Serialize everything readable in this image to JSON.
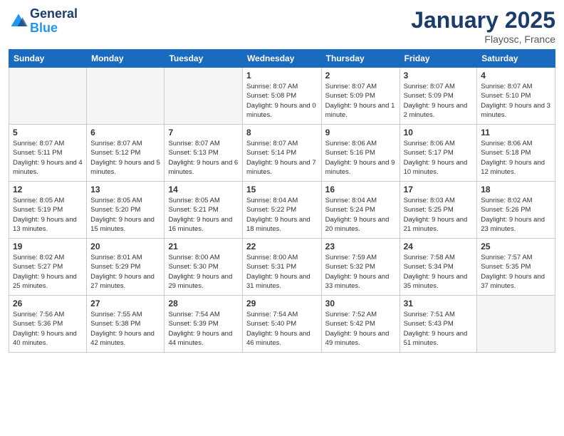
{
  "logo": {
    "line1": "General",
    "line2": "Blue"
  },
  "title": "January 2025",
  "location": "Flayosc, France",
  "days_of_week": [
    "Sunday",
    "Monday",
    "Tuesday",
    "Wednesday",
    "Thursday",
    "Friday",
    "Saturday"
  ],
  "weeks": [
    [
      {
        "num": "",
        "info": ""
      },
      {
        "num": "",
        "info": ""
      },
      {
        "num": "",
        "info": ""
      },
      {
        "num": "1",
        "info": "Sunrise: 8:07 AM\nSunset: 5:08 PM\nDaylight: 9 hours\nand 0 minutes."
      },
      {
        "num": "2",
        "info": "Sunrise: 8:07 AM\nSunset: 5:09 PM\nDaylight: 9 hours\nand 1 minute."
      },
      {
        "num": "3",
        "info": "Sunrise: 8:07 AM\nSunset: 5:09 PM\nDaylight: 9 hours\nand 2 minutes."
      },
      {
        "num": "4",
        "info": "Sunrise: 8:07 AM\nSunset: 5:10 PM\nDaylight: 9 hours\nand 3 minutes."
      }
    ],
    [
      {
        "num": "5",
        "info": "Sunrise: 8:07 AM\nSunset: 5:11 PM\nDaylight: 9 hours\nand 4 minutes."
      },
      {
        "num": "6",
        "info": "Sunrise: 8:07 AM\nSunset: 5:12 PM\nDaylight: 9 hours\nand 5 minutes."
      },
      {
        "num": "7",
        "info": "Sunrise: 8:07 AM\nSunset: 5:13 PM\nDaylight: 9 hours\nand 6 minutes."
      },
      {
        "num": "8",
        "info": "Sunrise: 8:07 AM\nSunset: 5:14 PM\nDaylight: 9 hours\nand 7 minutes."
      },
      {
        "num": "9",
        "info": "Sunrise: 8:06 AM\nSunset: 5:16 PM\nDaylight: 9 hours\nand 9 minutes."
      },
      {
        "num": "10",
        "info": "Sunrise: 8:06 AM\nSunset: 5:17 PM\nDaylight: 9 hours\nand 10 minutes."
      },
      {
        "num": "11",
        "info": "Sunrise: 8:06 AM\nSunset: 5:18 PM\nDaylight: 9 hours\nand 12 minutes."
      }
    ],
    [
      {
        "num": "12",
        "info": "Sunrise: 8:05 AM\nSunset: 5:19 PM\nDaylight: 9 hours\nand 13 minutes."
      },
      {
        "num": "13",
        "info": "Sunrise: 8:05 AM\nSunset: 5:20 PM\nDaylight: 9 hours\nand 15 minutes."
      },
      {
        "num": "14",
        "info": "Sunrise: 8:05 AM\nSunset: 5:21 PM\nDaylight: 9 hours\nand 16 minutes."
      },
      {
        "num": "15",
        "info": "Sunrise: 8:04 AM\nSunset: 5:22 PM\nDaylight: 9 hours\nand 18 minutes."
      },
      {
        "num": "16",
        "info": "Sunrise: 8:04 AM\nSunset: 5:24 PM\nDaylight: 9 hours\nand 20 minutes."
      },
      {
        "num": "17",
        "info": "Sunrise: 8:03 AM\nSunset: 5:25 PM\nDaylight: 9 hours\nand 21 minutes."
      },
      {
        "num": "18",
        "info": "Sunrise: 8:02 AM\nSunset: 5:26 PM\nDaylight: 9 hours\nand 23 minutes."
      }
    ],
    [
      {
        "num": "19",
        "info": "Sunrise: 8:02 AM\nSunset: 5:27 PM\nDaylight: 9 hours\nand 25 minutes."
      },
      {
        "num": "20",
        "info": "Sunrise: 8:01 AM\nSunset: 5:29 PM\nDaylight: 9 hours\nand 27 minutes."
      },
      {
        "num": "21",
        "info": "Sunrise: 8:00 AM\nSunset: 5:30 PM\nDaylight: 9 hours\nand 29 minutes."
      },
      {
        "num": "22",
        "info": "Sunrise: 8:00 AM\nSunset: 5:31 PM\nDaylight: 9 hours\nand 31 minutes."
      },
      {
        "num": "23",
        "info": "Sunrise: 7:59 AM\nSunset: 5:32 PM\nDaylight: 9 hours\nand 33 minutes."
      },
      {
        "num": "24",
        "info": "Sunrise: 7:58 AM\nSunset: 5:34 PM\nDaylight: 9 hours\nand 35 minutes."
      },
      {
        "num": "25",
        "info": "Sunrise: 7:57 AM\nSunset: 5:35 PM\nDaylight: 9 hours\nand 37 minutes."
      }
    ],
    [
      {
        "num": "26",
        "info": "Sunrise: 7:56 AM\nSunset: 5:36 PM\nDaylight: 9 hours\nand 40 minutes."
      },
      {
        "num": "27",
        "info": "Sunrise: 7:55 AM\nSunset: 5:38 PM\nDaylight: 9 hours\nand 42 minutes."
      },
      {
        "num": "28",
        "info": "Sunrise: 7:54 AM\nSunset: 5:39 PM\nDaylight: 9 hours\nand 44 minutes."
      },
      {
        "num": "29",
        "info": "Sunrise: 7:54 AM\nSunset: 5:40 PM\nDaylight: 9 hours\nand 46 minutes."
      },
      {
        "num": "30",
        "info": "Sunrise: 7:52 AM\nSunset: 5:42 PM\nDaylight: 9 hours\nand 49 minutes."
      },
      {
        "num": "31",
        "info": "Sunrise: 7:51 AM\nSunset: 5:43 PM\nDaylight: 9 hours\nand 51 minutes."
      },
      {
        "num": "",
        "info": ""
      }
    ]
  ]
}
